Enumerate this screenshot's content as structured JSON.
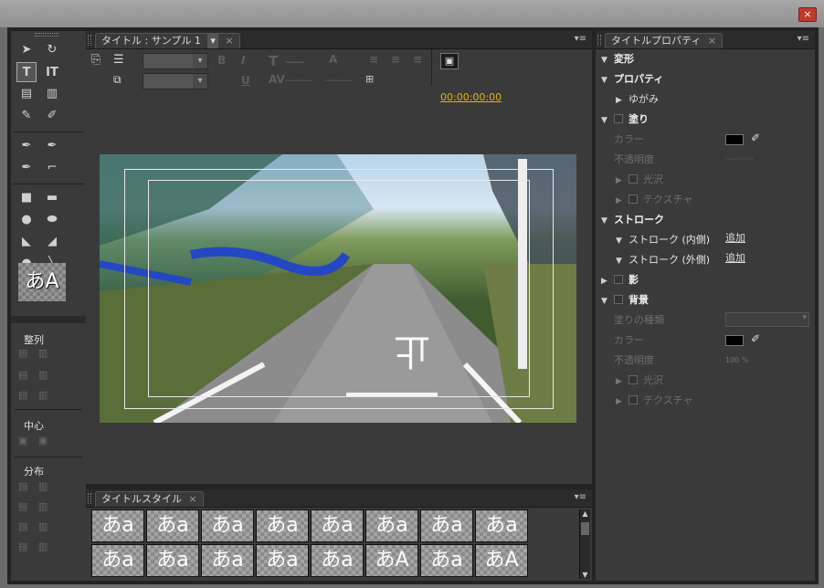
{
  "window": {
    "close_label": "×"
  },
  "tools": {
    "style_preview": "あA",
    "align_label": "整列",
    "center_label": "中心",
    "distribute_label": "分布"
  },
  "title_panel": {
    "tab_label": "タイトル : サンプル 1",
    "tab_close": "×",
    "timecode": "00:00:00:00"
  },
  "styles_panel": {
    "tab_label": "タイトルスタイル",
    "tab_close": "×",
    "swatches": [
      "あa",
      "あa",
      "あa",
      "あa",
      "あa",
      "あa",
      "あa",
      "あa",
      "あa",
      "あa",
      "あa",
      "あa",
      "あa",
      "あA",
      "あa",
      "あA"
    ]
  },
  "props_panel": {
    "tab_label": "タイトルプロパティ",
    "tab_close": "×",
    "transform": "変形",
    "properties": "プロパティ",
    "distort": "ゆがみ",
    "fill": "塗り",
    "color": "カラー",
    "opacity": "不透明度",
    "sheen": "光沢",
    "texture": "テクスチャ",
    "stroke": "ストローク",
    "inner_stroke": "ストローク (内側)",
    "outer_stroke": "ストローク (外側)",
    "add": "追加",
    "shadow": "影",
    "background": "背景",
    "fill_type": "塗りの種類",
    "bg_color": "カラー",
    "bg_opacity": "不透明度",
    "bg_opacity_value": "100 %",
    "bg_sheen": "光沢",
    "bg_texture": "テクスチャ"
  },
  "colors": {
    "accent_timecode": "#e8b400",
    "close_red": "#c0392b"
  }
}
